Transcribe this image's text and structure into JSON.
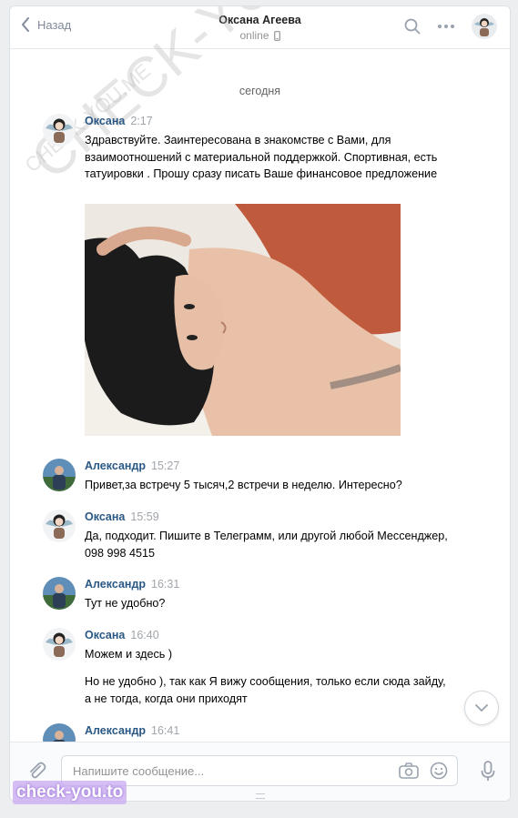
{
  "header": {
    "back_label": "Назад",
    "title": "Оксана Агеева",
    "status": "online"
  },
  "watermarks": [
    "CHECK-YOU.ME",
    "CHECK-YOU.ME"
  ],
  "day_separator": "сегодня",
  "messages": [
    {
      "author": "Оксана",
      "time": "2:17",
      "text": "Здравствуйте. Заинтересована в знакомстве с Вами, для взаимоотношений с материальной поддержкой. Спортивная, есть татуировки . Прошу сразу писать Ваше финансовое предложение"
    },
    {
      "author": "Александр",
      "time": "15:27",
      "text": "Привет,за встречу 5 тысяч,2 встречи в неделю. Интересно?"
    },
    {
      "author": "Оксана",
      "time": "15:59",
      "text": "Да, подходит. Пишите в Телеграмм, или другой любой Мессенджер, 098 998 4515"
    },
    {
      "author": "Александр",
      "time": "16:31",
      "text": "Тут не удобно?"
    },
    {
      "author": "Оксана",
      "time": "16:40",
      "text": "Можем и здесь )",
      "text2": "Но не удобно ), так как Я вижу сообщения, только если сюда зайду, а не тогда, когда они приходят"
    },
    {
      "author": "Александр",
      "time": "16:41",
      "text": ""
    }
  ],
  "composer": {
    "placeholder": "Напишите сообщение..."
  },
  "brand_label": "check-you.to",
  "colors": {
    "link": "#2a5885",
    "background": "#edeef0",
    "panel": "#ffffff"
  }
}
